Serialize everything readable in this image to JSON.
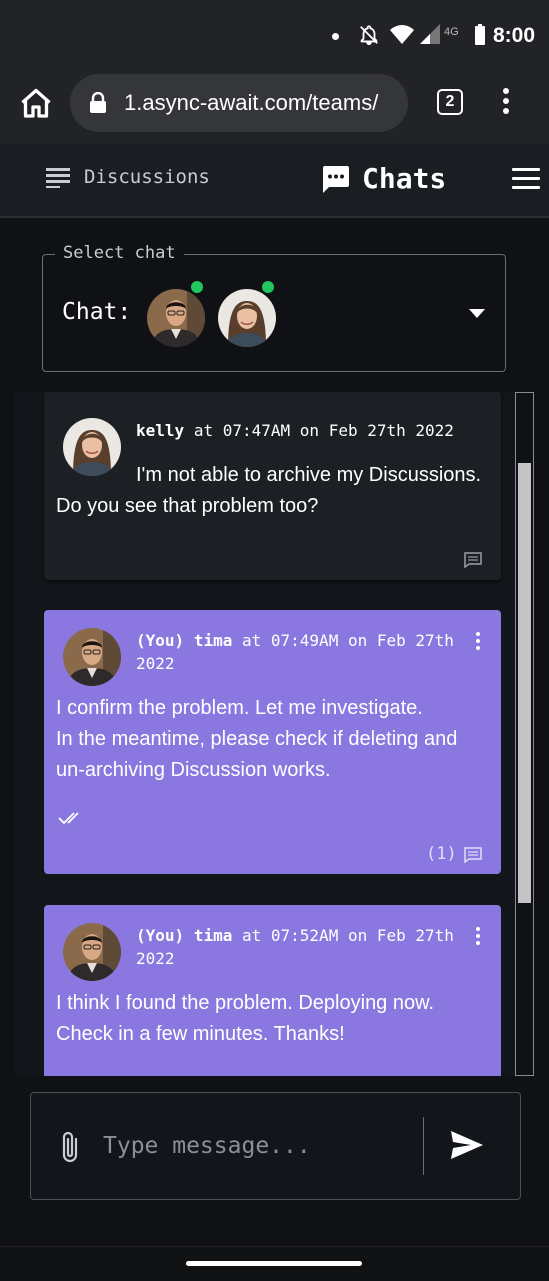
{
  "status_bar": {
    "time": "8:00",
    "network": "4G"
  },
  "browser": {
    "url": "1.async-await.com/teams/",
    "tab_count": "2"
  },
  "header": {
    "discussions_label": "Discussions",
    "chats_label": "Chats"
  },
  "chat_select": {
    "legend": "Select chat",
    "label": "Chat:"
  },
  "messages": [
    {
      "author": "kelly",
      "you_prefix": "",
      "at": "at",
      "time": "07:47AM",
      "on": "on",
      "date": "Feb 27th 2022",
      "line1": "I'm not able to archive my Discussions.",
      "line2": "Do you see that problem too?"
    },
    {
      "author": "tima",
      "you_prefix": "(You)",
      "at": "at",
      "time": "07:49AM",
      "on": "on",
      "date_part1": "Feb 27th",
      "date_part2": "2022",
      "line1": "I confirm the problem. Let me investigate.",
      "line2": "In the meantime, please check if deleting and",
      "line3": "un-archiving Discussion works.",
      "reply_count": "(1)"
    },
    {
      "author": "tima",
      "you_prefix": "(You)",
      "at": "at",
      "time": "07:52AM",
      "on": "on",
      "date_part1": "Feb 27th",
      "date_part2": "2022",
      "line1": "I think I found the problem. Deploying now.",
      "line2": "Check in a few minutes. Thanks!"
    }
  ],
  "composer": {
    "placeholder": "Type message..."
  },
  "colors": {
    "own_message_bg": "#8a78e0",
    "online": "#22c55e",
    "app_bg": "#0f1115"
  }
}
